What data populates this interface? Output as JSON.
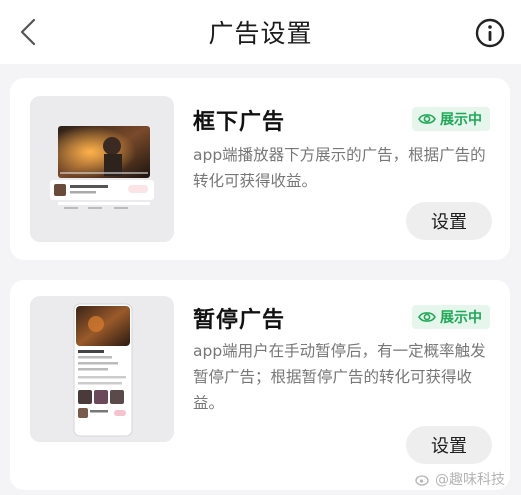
{
  "header": {
    "title": "广告设置"
  },
  "icons": {
    "back": "chevron-left-icon",
    "info": "info-circle-icon",
    "status": "eye-icon"
  },
  "colors": {
    "status_green": "#1fa957",
    "status_bg": "#e6f6ec",
    "button_bg": "#eeeeee"
  },
  "ads": [
    {
      "title": "框下广告",
      "status": "展示中",
      "description": "app端播放器下方展示的广告，根据广告的转化可获得收益。",
      "settings_label": "设置"
    },
    {
      "title": "暂停广告",
      "status": "展示中",
      "description": "app端用户在手动暂停后，有一定概率触发暂停广告；根据暂停广告的转化可获得收益。",
      "settings_label": "设置"
    }
  ],
  "watermark": "@趣味科技"
}
